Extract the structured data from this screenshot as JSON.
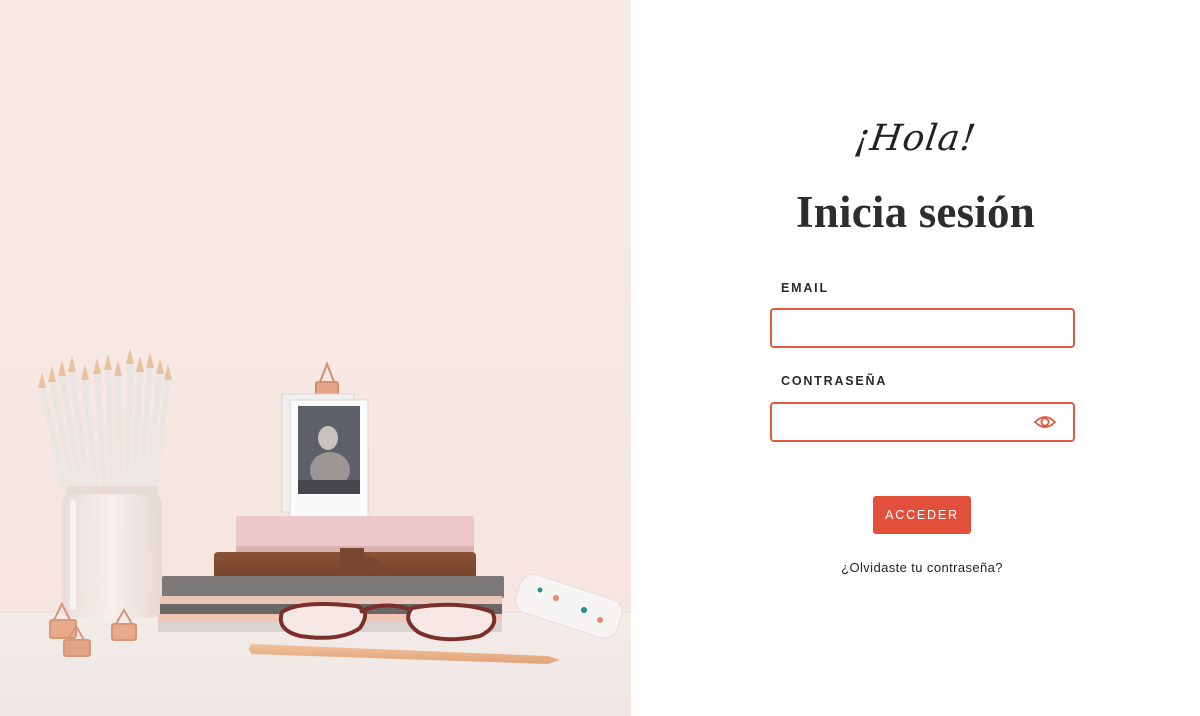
{
  "colors": {
    "accent": "#e2503c",
    "field_border": "#e2593e",
    "hero_wall": "#f7e8e3",
    "text_dark": "#2f2d2c"
  },
  "login": {
    "greeting": "¡Hola!",
    "title": "Inicia sesión",
    "email_label": "EMAIL",
    "email_value": "",
    "password_label": "CONTRASEÑA",
    "password_value": "",
    "show_password_icon": "eye-icon",
    "submit_label": "ACCEDER",
    "forgot_link": "¿Olvidaste tu contraseña?"
  }
}
